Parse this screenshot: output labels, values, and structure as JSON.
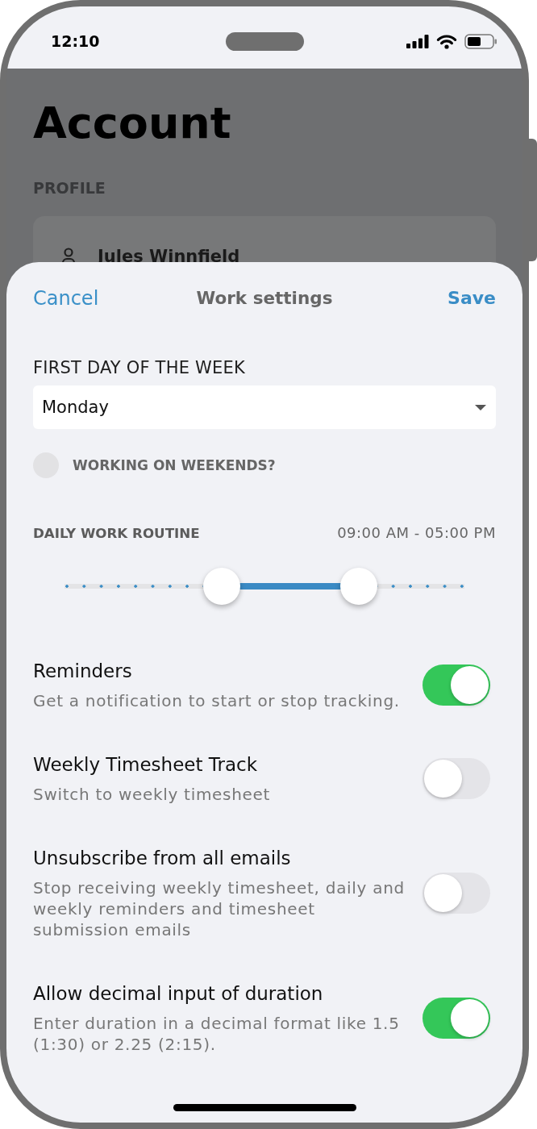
{
  "status_bar": {
    "time": "12:10"
  },
  "background_page": {
    "title": "Account",
    "section_label": "PROFILE",
    "profile_name": "Jules Winnfield"
  },
  "sheet": {
    "cancel_button": "Cancel",
    "title": "Work settings",
    "save_button": "Save"
  },
  "first_day": {
    "label": "FIRST DAY OF THE WEEK",
    "value": "Monday"
  },
  "weekends": {
    "label": "WORKING ON WEEKENDS?",
    "checked": false
  },
  "work_routine": {
    "label": "DAILY WORK ROUTINE",
    "reading": "09:00 AM - 05:00 PM",
    "thumbs": [
      {
        "level": 0.393
      },
      {
        "level": 0.735
      }
    ]
  },
  "settings": [
    {
      "title": "Reminders",
      "description": "Get a notification to start or stop tracking.",
      "on": true
    },
    {
      "title": "Weekly Timesheet Track",
      "description": "Switch to weekly timesheet",
      "on": false
    },
    {
      "title": "Unsubscribe from all emails",
      "description": "Stop receiving weekly timesheet, daily and weekly reminders and timesheet submission emails",
      "on": false
    },
    {
      "title": "Allow decimal input of duration",
      "description": "Enter duration in a decimal format like 1.5 (1:30) or 2.25 (2:15).",
      "on": true
    }
  ]
}
